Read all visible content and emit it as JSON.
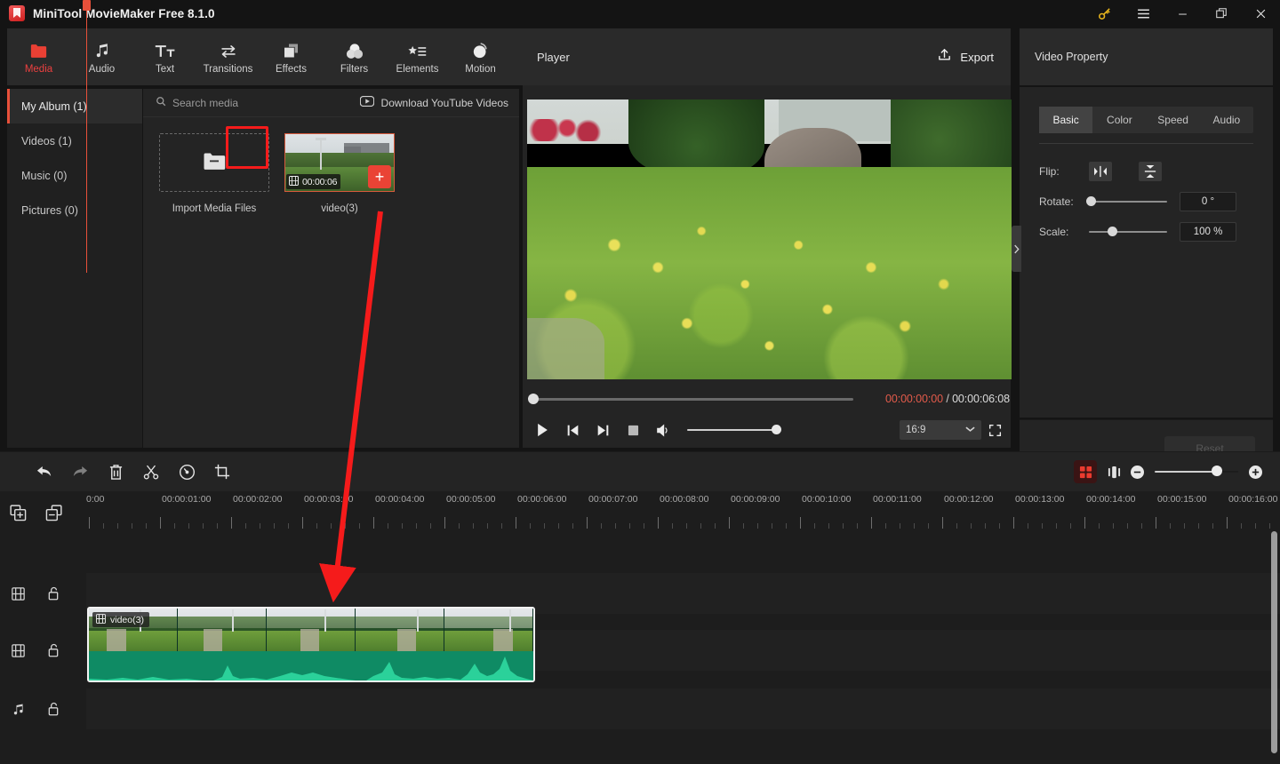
{
  "window": {
    "title": "MiniTool MovieMaker Free 8.1.0",
    "logo_icon": "app-logo-icon",
    "controls": [
      {
        "name": "key-icon",
        "glyph": "⚿"
      },
      {
        "name": "menu-icon",
        "glyph": "☰"
      },
      {
        "name": "minimize-icon",
        "glyph": "─"
      },
      {
        "name": "restore-icon",
        "glyph": "❐"
      },
      {
        "name": "close-icon",
        "glyph": "✕"
      }
    ]
  },
  "toolbar": {
    "items": [
      {
        "label": "Media",
        "icon": "folder-icon",
        "active": true
      },
      {
        "label": "Audio",
        "icon": "music-note-icon",
        "active": false
      },
      {
        "label": "Text",
        "icon": "text-tt-icon",
        "active": false
      },
      {
        "label": "Transitions",
        "icon": "transitions-arrows-icon",
        "active": false
      },
      {
        "label": "Effects",
        "icon": "effects-squares-icon",
        "active": false
      },
      {
        "label": "Filters",
        "icon": "filters-droplets-icon",
        "active": false
      },
      {
        "label": "Elements",
        "icon": "elements-star-list-icon",
        "active": false
      },
      {
        "label": "Motion",
        "icon": "motion-sphere-icon",
        "active": false
      }
    ]
  },
  "albums": {
    "items": [
      {
        "label": "My Album (1)",
        "active": true
      },
      {
        "label": "Videos (1)",
        "active": false
      },
      {
        "label": "Music (0)",
        "active": false
      },
      {
        "label": "Pictures (0)",
        "active": false
      }
    ]
  },
  "media": {
    "search_placeholder": "Search media",
    "search_icon": "search-icon",
    "download_label": "Download YouTube Videos",
    "download_icon": "youtube-icon",
    "import_label": "Import Media Files",
    "import_icon": "folder-plus-icon",
    "clip": {
      "name": "video(3)",
      "duration": "00:00:06",
      "duration_icon": "filmstrip-icon",
      "add_label": "+",
      "add_icon": "plus-icon"
    }
  },
  "player": {
    "title": "Player",
    "export_label": "Export",
    "export_icon": "upload-icon",
    "current_time": "00:00:00:00",
    "separator": "/",
    "total_time": "00:00:06:08",
    "seek_percent": 0,
    "volume_percent": 100,
    "aspect_ratio": "16:9",
    "controls": [
      {
        "name": "play-button",
        "icon": "play-icon"
      },
      {
        "name": "previous-frame-button",
        "icon": "skip-back-icon"
      },
      {
        "name": "next-frame-button",
        "icon": "skip-forward-icon"
      },
      {
        "name": "stop-button",
        "icon": "stop-icon"
      },
      {
        "name": "volume-button",
        "icon": "speaker-icon"
      }
    ],
    "fullscreen_icon": "fullscreen-icon",
    "chevron_icon": "chevron-down-icon"
  },
  "property": {
    "title": "Video Property",
    "tabs": [
      {
        "label": "Basic",
        "active": true
      },
      {
        "label": "Color",
        "active": false
      },
      {
        "label": "Speed",
        "active": false
      },
      {
        "label": "Audio",
        "active": false
      }
    ],
    "flip_label": "Flip:",
    "flip_horizontal_icon": "flip-horizontal-icon",
    "flip_vertical_icon": "flip-vertical-icon",
    "rotate_label": "Rotate:",
    "rotate_value": "0 °",
    "rotate_percent": 0,
    "scale_label": "Scale:",
    "scale_value": "100 %",
    "scale_percent": 28,
    "reset_label": "Reset",
    "collapse_icon": "chevron-right-icon"
  },
  "timeline_toolbar": {
    "buttons": [
      {
        "name": "undo-button",
        "icon": "undo-icon"
      },
      {
        "name": "redo-button",
        "icon": "redo-icon"
      },
      {
        "name": "delete-button",
        "icon": "trash-icon"
      },
      {
        "name": "split-button",
        "icon": "scissors-icon"
      },
      {
        "name": "speed-button",
        "icon": "speedometer-icon"
      },
      {
        "name": "crop-button",
        "icon": "crop-icon"
      }
    ],
    "right": [
      {
        "name": "keyframe-button",
        "icon": "keyframe-grid-icon"
      },
      {
        "name": "fit-timeline-button",
        "icon": "fit-width-icon"
      }
    ],
    "zoom_out_icon": "minus-circle-icon",
    "zoom_in_icon": "plus-circle-icon",
    "zoom_percent": 68
  },
  "timeline": {
    "add_track_icon": "add-track-icon",
    "remove_track_icon": "remove-track-icon",
    "ruler_labels": [
      "0:00",
      "00:00:01:00",
      "00:00:02:00",
      "00:00:03:00",
      "00:00:04:00",
      "00:00:05:00",
      "00:00:06:00",
      "00:00:07:00",
      "00:00:08:00",
      "00:00:09:00",
      "00:00:10:00",
      "00:00:11:00",
      "00:00:12:00",
      "00:00:13:00",
      "00:00:14:00",
      "00:00:15:00",
      "00:00:16:00"
    ],
    "tracks": [
      {
        "name": "video-track-1",
        "type_icon": "filmstrip-icon",
        "lock_icon": "unlock-icon"
      },
      {
        "name": "video-track-2",
        "type_icon": "filmstrip-icon",
        "lock_icon": "unlock-icon"
      },
      {
        "name": "audio-track-1",
        "type_icon": "music-note-icon",
        "lock_icon": "unlock-icon"
      }
    ],
    "clip": {
      "label": "video(3)",
      "icon": "filmstrip-icon"
    },
    "playhead_position": "0:00"
  },
  "annotation": {
    "arrow_color": "#f51b1b",
    "highlight_color": "#f51b1b"
  }
}
